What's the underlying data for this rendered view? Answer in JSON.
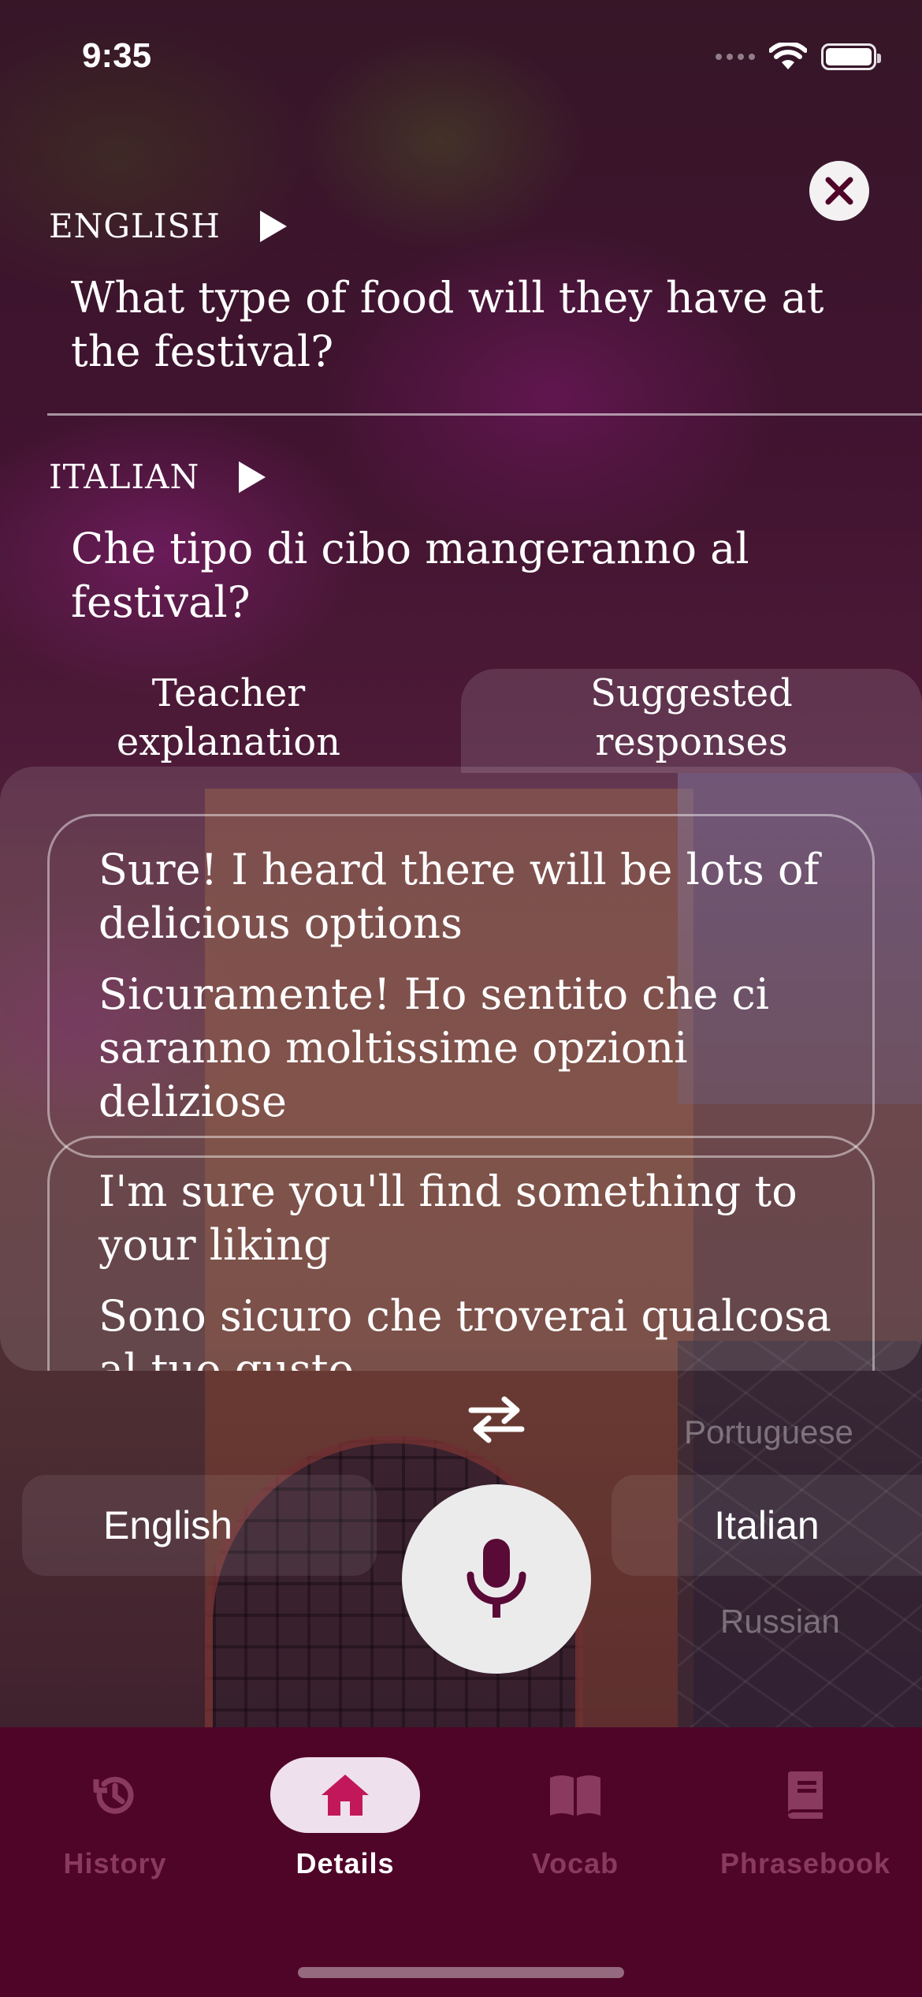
{
  "status_bar": {
    "time": "9:35"
  },
  "source": {
    "label": "ENGLISH",
    "text": "What type of food will they have at the festival?"
  },
  "target": {
    "label": "ITALIAN",
    "text": "Che tipo di cibo mangeranno al festival?"
  },
  "tabs": [
    {
      "label_line1": "Teacher",
      "label_line2": "explanation"
    },
    {
      "label_line1": "Suggested",
      "label_line2": "responses"
    }
  ],
  "responses": [
    {
      "en": "Sure! I heard there will be lots of delicious options",
      "it": "Sicuramente! Ho sentito che ci saranno moltissime opzioni deliziose"
    },
    {
      "en": "I'm sure you'll find something to your liking",
      "it": "Sono sicuro che troverai qualcosa al tuo gusto"
    }
  ],
  "language_picker": {
    "left": "English",
    "right": "Italian",
    "right_above": "Portuguese",
    "right_below": "Russian"
  },
  "nav": [
    {
      "label": "History",
      "icon": "history-icon"
    },
    {
      "label": "Details",
      "icon": "home-icon"
    },
    {
      "label": "Vocab",
      "icon": "book-open-icon"
    },
    {
      "label": "Phrasebook",
      "icon": "book-icon"
    }
  ],
  "colors": {
    "nav_bg": "#4f0528",
    "accent": "#c2185b",
    "active_pill": "#efe0ee",
    "inactive_nav": "#8a3a5e"
  }
}
